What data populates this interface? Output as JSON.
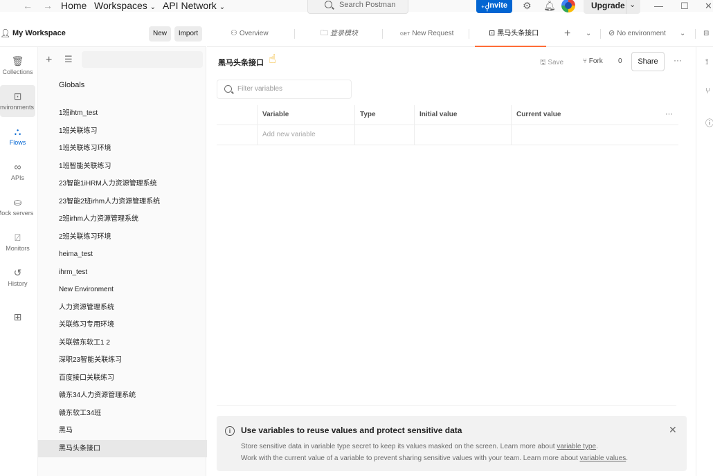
{
  "topbar": {
    "nav_home": "Home",
    "nav_workspaces": "Workspaces",
    "nav_api_network": "API Network",
    "search_placeholder": "Search Postman",
    "invite_label": "Invite",
    "upgrade_label": "Upgrade"
  },
  "workspace": {
    "name": "My Workspace",
    "new_label": "New",
    "import_label": "Import"
  },
  "rail": [
    {
      "label": "Collections",
      "icon": "collections-icon"
    },
    {
      "label": "Environments",
      "icon": "environments-icon"
    },
    {
      "label": "Flows",
      "icon": "flows-icon"
    },
    {
      "label": "APIs",
      "icon": "apis-icon"
    },
    {
      "label": "Mock servers",
      "icon": "mock-servers-icon"
    },
    {
      "label": "Monitors",
      "icon": "monitors-icon"
    },
    {
      "label": "History",
      "icon": "history-icon"
    }
  ],
  "sidebar": {
    "globals": "Globals",
    "environments": [
      "1班ihtm_test",
      "1班关联练习",
      "1班关联练习环境",
      "1班智能关联练习",
      "23智能1iHRM人力资源管理系统",
      "23智能2班irhm人力资源管理系统",
      "2班irhm人力资源管理系统",
      "2班关联练习环境",
      "heima_test",
      "ihrm_test",
      "New Environment",
      "人力资源管理系统",
      "关联练习专用环境",
      "关联赣东软工1 2",
      "深职23智能关联练习",
      "百度接口关联练习",
      "赣东34人力资源管理系统",
      "赣东软工34班",
      "黑马",
      "黑马头条接口"
    ]
  },
  "tabs": {
    "overview": "Overview",
    "folder": "登录模块",
    "get_method": "GET",
    "new_request": "New Request",
    "current": "黑马头条接口",
    "no_environment": "No environment"
  },
  "editor": {
    "title": "黑马头条接口",
    "save_label": "Save",
    "fork_label": "Fork",
    "fork_count": "0",
    "share_label": "Share",
    "filter_placeholder": "Filter variables",
    "columns": [
      "Variable",
      "Type",
      "Initial value",
      "Current value"
    ],
    "add_new_variable": "Add new variable"
  },
  "banner": {
    "title": "Use variables to reuse values and protect sensitive data",
    "line1_text": "Store sensitive data in variable type secret to keep its values masked on the screen. Learn more about ",
    "line1_link": "variable type",
    "line1_end": ".",
    "line2_text": "Work with the current value of a variable to prevent sharing sensitive values with your team. Learn more about ",
    "line2_link": "variable values",
    "line2_end": "."
  },
  "colors": {
    "accent": "#0265d2",
    "active_tab": "#ff6c37"
  }
}
